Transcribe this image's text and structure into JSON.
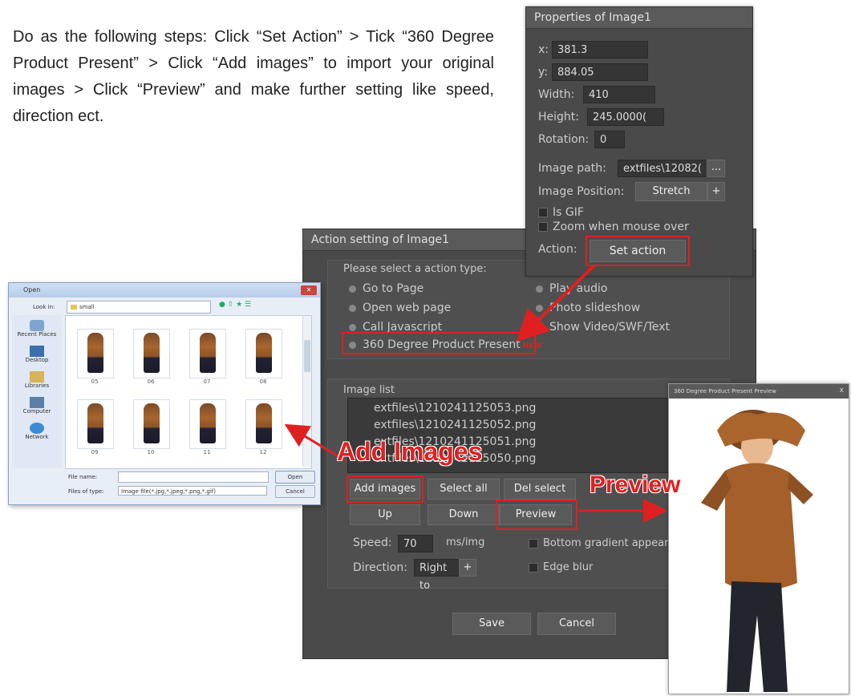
{
  "instructions": "Do as the following steps: Click “Set Action” > Tick “360 Degree Product Present” > Click “Add images” to import your original images > Click “Preview” and make further setting like speed, direction ect.",
  "properties": {
    "title": "Properties of Image1",
    "x_label": "x:",
    "x_value": "381.3",
    "y_label": "y:",
    "y_value": "884.05",
    "width_label": "Width:",
    "width_value": "410",
    "height_label": "Height:",
    "height_value": "245.0000(",
    "rotation_label": "Rotation:",
    "rotation_value": "0",
    "image_path_label": "Image path:",
    "image_path_value": "extfiles\\12082(",
    "browse_button": "...",
    "image_position_label": "Image Position:",
    "image_position_value": "Stretch",
    "plus": "+",
    "is_gif": "Is GIF",
    "zoom": "Zoom when mouse over",
    "action_label": "Action:",
    "set_action_button": "Set action"
  },
  "action_setting": {
    "title": "Action setting of Image1",
    "select_label": "Please select a action type:",
    "options_left": [
      "Go to Page",
      "Open web page",
      "Call Javascript",
      "360 Degree Product Present"
    ],
    "options_right": [
      "Play audio",
      "Photo slideshow",
      "Show Video/SWF/Text"
    ],
    "new_badge": "NEW",
    "image_list_label": "Image list",
    "images": [
      "extfiles\\1210241125053.png",
      "extfiles\\1210241125052.png",
      "extfiles\\1210241125051.png",
      "extfiles\\1210241125050.png"
    ],
    "buttons": {
      "add_images": "Add images",
      "select_all": "Select all",
      "del_select": "Del select",
      "up": "Up",
      "down": "Down",
      "preview": "Preview"
    },
    "speed_label": "Speed:",
    "speed_value": "70",
    "speed_unit": "ms/img",
    "direction_label": "Direction:",
    "direction_value": "Right to",
    "direction_plus": "+",
    "bottom_gradient": "Bottom gradient appear",
    "edge_blur": "Edge blur",
    "save": "Save",
    "cancel": "Cancel"
  },
  "callouts": {
    "add_images": "Add Images",
    "preview": "Preview"
  },
  "open_dialog": {
    "title": "Open",
    "look_in_label": "Look in:",
    "look_in_value": "small",
    "places": [
      "Recent Places",
      "Desktop",
      "Libraries",
      "Computer",
      "Network"
    ],
    "thumbs": [
      "05",
      "06",
      "07",
      "08",
      "09",
      "10",
      "11",
      "12"
    ],
    "file_name_label": "File name:",
    "files_of_type_label": "Files of type:",
    "files_of_type_value": "Image file(*.jpg,*.jpeg,*.png,*.gif)",
    "open_button": "Open",
    "cancel_button": "Cancel"
  },
  "preview_window": {
    "title": "360 Degree Product Present Preview",
    "close": "x"
  },
  "colors": {
    "panel": "#4a4a4a",
    "highlight": "#e02020"
  }
}
